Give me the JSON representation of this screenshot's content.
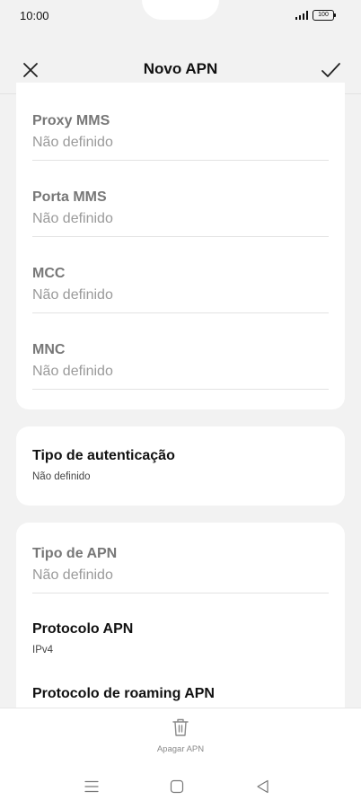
{
  "status": {
    "time": "10:00",
    "battery": "100"
  },
  "header": {
    "title": "Novo APN"
  },
  "mms_card": {
    "fields": [
      {
        "label": "Proxy MMS",
        "value": "Não definido"
      },
      {
        "label": "Porta MMS",
        "value": "Não definido"
      },
      {
        "label": "MCC",
        "value": "Não definido"
      },
      {
        "label": "MNC",
        "value": "Não definido"
      }
    ]
  },
  "auth_card": {
    "label": "Tipo de autenticação",
    "value": "Não definido"
  },
  "apn_card": {
    "type_label": "Tipo de APN",
    "type_value": "Não definido",
    "protocol_label": "Protocolo APN",
    "protocol_value": "IPv4",
    "roaming_label": "Protocolo de roaming APN"
  },
  "bottom": {
    "delete_label": "Apagar APN"
  }
}
